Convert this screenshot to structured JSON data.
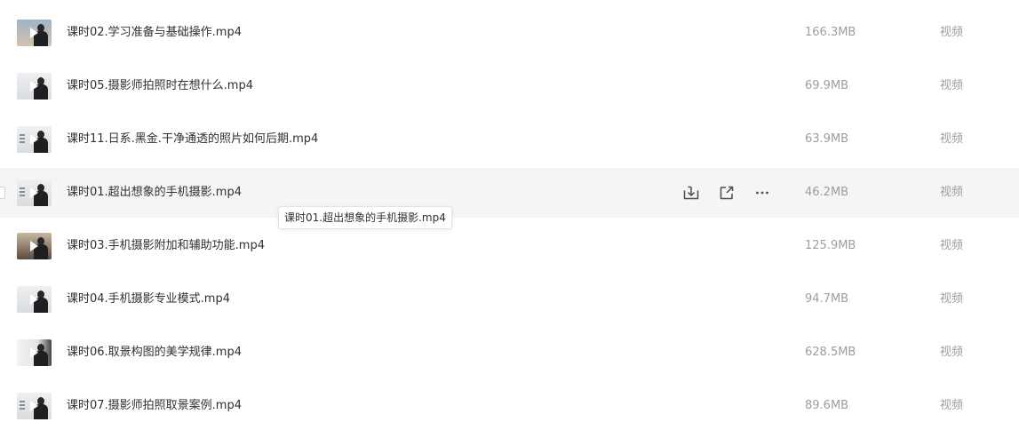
{
  "files": [
    {
      "name": "课时02.学习准备与基础操作.mp4",
      "size": "166.3MB",
      "type": "视频",
      "thumb": "blue"
    },
    {
      "name": "课时05.摄影师拍照时在想什么.mp4",
      "size": "69.9MB",
      "type": "视频",
      "thumb": "plain"
    },
    {
      "name": "课时11.日系.黑金.干净通透的照片如何后期.mp4",
      "size": "63.9MB",
      "type": "视频",
      "thumb": "dots"
    },
    {
      "name": "课时01.超出想象的手机摄影.mp4",
      "size": "46.2MB",
      "type": "视频",
      "thumb": "dots",
      "hovered": true
    },
    {
      "name": "课时03.手机摄影附加和辅助功能.mp4",
      "size": "125.9MB",
      "type": "视频",
      "thumb": "dark"
    },
    {
      "name": "课时04.手机摄影专业模式.mp4",
      "size": "94.7MB",
      "type": "视频",
      "thumb": "plain"
    },
    {
      "name": "课时06.取景构图的美学规律.mp4",
      "size": "628.5MB",
      "type": "视频",
      "thumb": "side"
    },
    {
      "name": "课时07.摄影师拍照取景案例.mp4",
      "size": "89.6MB",
      "type": "视频",
      "thumb": "dots"
    }
  ],
  "row_actions": {
    "download_icon": "download-icon",
    "share_icon": "share-icon",
    "more_icon": "more-icon"
  },
  "tooltip": {
    "text": "课时01.超出想象的手机摄影.mp4"
  },
  "colors": {
    "hover_row_bg": "#f5f5f6",
    "text_primary": "#2f3134",
    "text_secondary": "#9a9da3"
  }
}
